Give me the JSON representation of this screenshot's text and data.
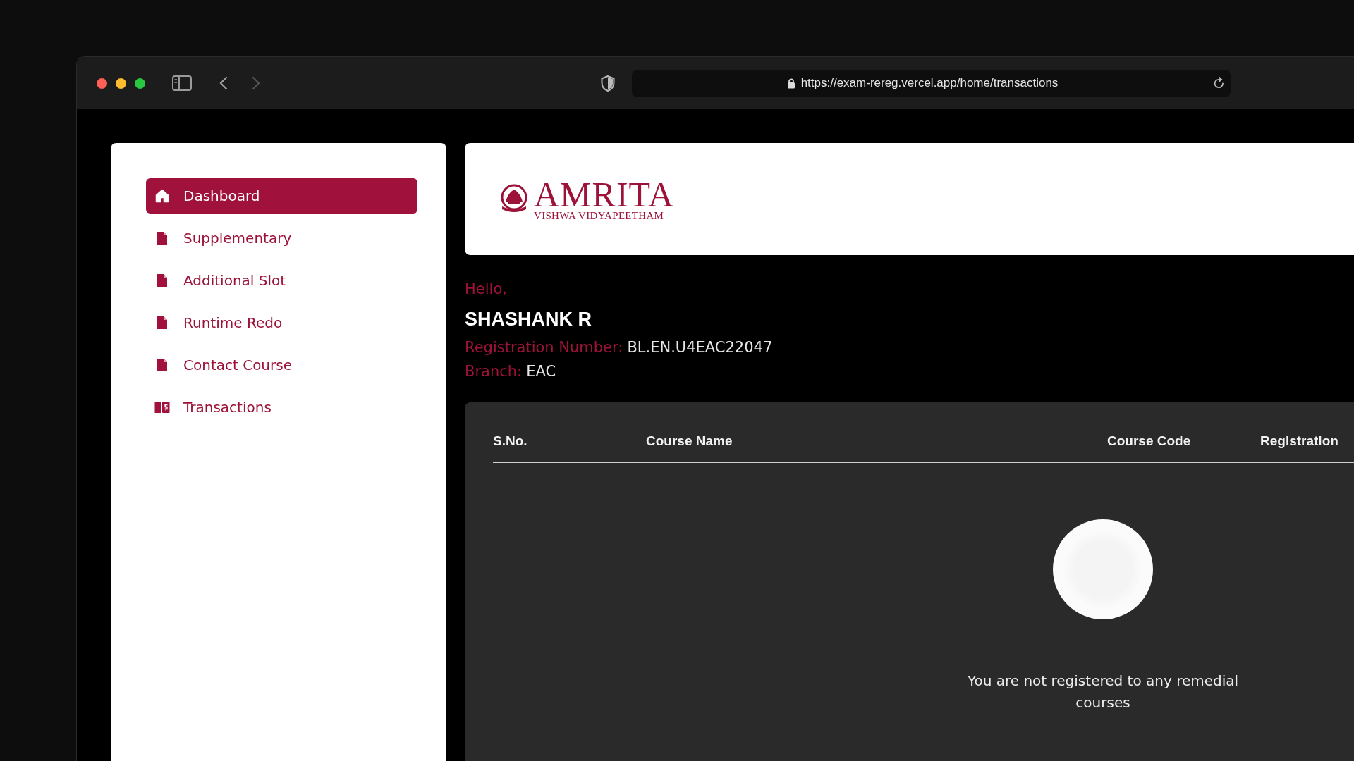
{
  "browser": {
    "url": "https://exam-rereg.vercel.app/home/transactions"
  },
  "sidebar": {
    "items": [
      {
        "label": "Dashboard",
        "kind": "home",
        "selected": true
      },
      {
        "label": "Supplementary",
        "kind": "file",
        "selected": false
      },
      {
        "label": "Additional Slot",
        "kind": "file",
        "selected": false
      },
      {
        "label": "Runtime Redo",
        "kind": "file",
        "selected": false
      },
      {
        "label": "Contact Course",
        "kind": "file",
        "selected": false
      },
      {
        "label": "Transactions",
        "kind": "ledger",
        "selected": false
      }
    ]
  },
  "logo": {
    "name": "AMRITA",
    "subtitle": "VISHWA VIDYAPEETHAM"
  },
  "greeting": "Hello,",
  "student": {
    "name": "SHASHANK R",
    "fields": [
      {
        "label": "Registration Number:",
        "value": "BL.EN.U4EAC22047"
      },
      {
        "label": "Branch:",
        "value": "EAC"
      }
    ]
  },
  "table": {
    "columns": [
      "S.No.",
      "Course Name",
      "Course Code",
      "Registration"
    ],
    "empty_message": "You are not registered to any remedial courses"
  }
}
